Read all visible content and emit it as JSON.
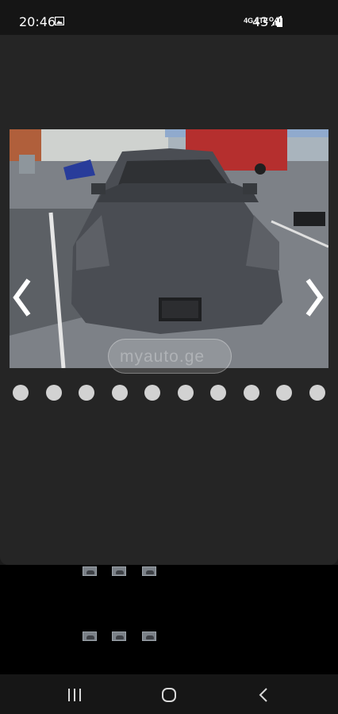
{
  "status_bar": {
    "time": "20:46",
    "network": "4G LTE",
    "battery": "43%",
    "icons": [
      "gallery-icon",
      "signal-icon",
      "battery-icon"
    ]
  },
  "gallery": {
    "watermark": "myauto.ge",
    "dot_count": 10,
    "arrows": [
      "chevron-left-icon",
      "chevron-right-icon"
    ]
  },
  "thumbnails": {
    "rows": 2,
    "per_row": 3
  },
  "system_nav": {
    "buttons": [
      "recent-apps-button",
      "home-button",
      "back-button"
    ]
  },
  "colors": {
    "modal_bg": "#252525",
    "dot": "#d2d2d2",
    "thumb_bg": "#000000"
  }
}
